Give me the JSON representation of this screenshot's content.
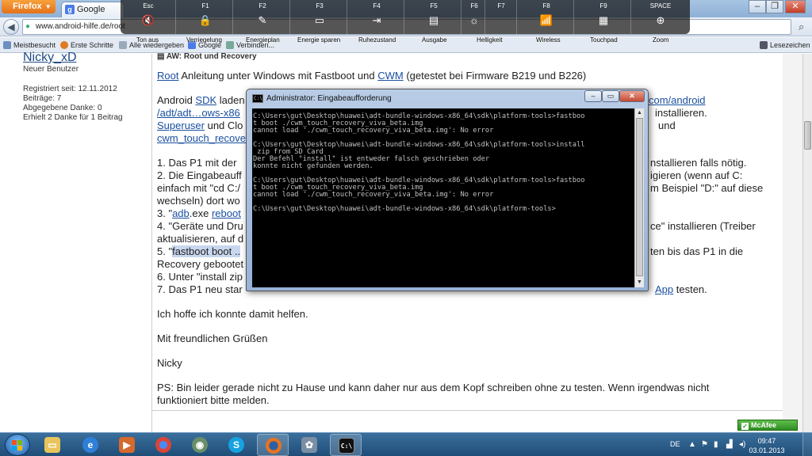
{
  "browser": {
    "menu_button": "Firefox",
    "tab_title": "Google",
    "url": "www.android-hilfe.de/root",
    "bookmarks": [
      "Meistbesucht",
      "Erste Schritte",
      "Alle wiedergeben",
      "Google",
      "Verbinden..."
    ],
    "bookmarks_right": "Lesezeichen"
  },
  "fn_keys": [
    {
      "key": "Esc",
      "glyph": "🔇",
      "label": "Ton aus"
    },
    {
      "key": "F1",
      "glyph": "🔒",
      "label": "Verriegelung"
    },
    {
      "key": "F2",
      "glyph": "✎",
      "label": "Energieplan"
    },
    {
      "key": "F3",
      "glyph": "⚡",
      "label": "Energie sparen"
    },
    {
      "key": "F4",
      "glyph": "☾",
      "label": "Ruhezustand"
    },
    {
      "key": "F5",
      "glyph": "▭",
      "label": "Ausgabe"
    },
    {
      "key": "F6",
      "glyph": "☀",
      "label": "Helligkeit"
    },
    {
      "key": "F7",
      "glyph": "",
      "label": ""
    },
    {
      "key": "F8",
      "glyph": "((·))",
      "label": "Wireless"
    },
    {
      "key": "F9",
      "glyph": "▦",
      "label": "Touchpad"
    },
    {
      "key": "SPACE",
      "glyph": "⊕",
      "label": "Zoom"
    }
  ],
  "sidebar": {
    "username": "Nicky_xD",
    "rank": "Neuer Benutzer",
    "registered": "Registriert seit: 12.11.2012",
    "posts": "Beiträge: 7",
    "thanks_given": "Abgegebene Danke: 0",
    "thanks_received": "Erhielt 2 Danke für 1 Beitrag"
  },
  "post": {
    "heading": "AW: Root und Recovery",
    "intro_pre": " Anleitung unter Windows mit Fastboot und ",
    "intro_root": "Root",
    "intro_cwm": "CWM",
    "intro_post": " (getestet bei Firmware B219 und B226)",
    "sdk_a": "Android ",
    "sdk_b": "SDK",
    "sdk_c": " laden",
    "sdk_right": "com/android",
    "adt_link": "/adt/adt…ows-x86",
    "installieren": "installieren.",
    "superuser": "Superuser",
    "und_clo": " und Clo",
    "und": "und",
    "cwm_file": "cwm_touch_recove",
    "step1_a": "1. Das P1 mit der",
    "step1_b": "nstallieren falls nötig.",
    "step2_a": "2. Die Eingabeauff",
    "step2_b": "igieren (wenn auf C:",
    "step2c_a": "einfach mit \"cd C:/",
    "step2c_b": "m Beispiel \"D:\" auf diese",
    "step2d_a": "wechseln) dort wo",
    "step3_a": "3. \"",
    "step3_adb": "adb",
    "step3_b": ".exe ",
    "step3_reboot": "reboot",
    "step4_a": "4. \"Geräte und Dru",
    "step4_b": "ce\" installieren (Treiber",
    "step4c_a": "aktualisieren, auf d",
    "step5_a": "5. \"",
    "step5_hl": "fastboot boot ..",
    "step5_b": "ten bis das P1 in die",
    "step5c_a": "Recovery gebootet",
    "step6_a": "6. Unter \"install zip",
    "step7_a": "7. Das P1 neu star",
    "step7_app": "App",
    "step7_b": " testen.",
    "hope": "Ich hoffe ich konnte damit helfen.",
    "greeting": "Mit freundlichen Grüßen",
    "name": "Nicky",
    "ps1": "PS: Bin leider gerade nicht zu Hause und kann daher nur aus dem Kopf schreiben ohne zu testen. Wenn irgendwas nicht",
    "ps2": "funktioniert bitte melden."
  },
  "cmd": {
    "title": "Administrator: Eingabeaufforderung",
    "lines": [
      "C:\\Users\\gut\\Desktop\\huawei\\adt-bundle-windows-x86_64\\sdk\\platform-tools>fastboo",
      "t boot ./cwm_touch_recovery_viva_beta.img",
      "cannot load './cwm_touch_recovery_viva_beta.img': No error",
      "",
      "C:\\Users\\gut\\Desktop\\huawei\\adt-bundle-windows-x86_64\\sdk\\platform-tools>install",
      " zip from SD Card",
      "Der Befehl \"install\" ist entweder falsch geschrieben oder",
      "konnte nicht gefunden werden.",
      "",
      "C:\\Users\\gut\\Desktop\\huawei\\adt-bundle-windows-x86_64\\sdk\\platform-tools>fastboo",
      "t boot ./cwm_touch_recovery_viva_beta.img",
      "cannot load './cwm_touch_recovery_viva_beta.img': No error",
      "",
      "C:\\Users\\gut\\Desktop\\huawei\\adt-bundle-windows-x86_64\\sdk\\platform-tools>"
    ]
  },
  "mcafee": "McAfee",
  "taskbar": {
    "language": "DE",
    "time": "09:47",
    "date": "03.01.2013"
  }
}
